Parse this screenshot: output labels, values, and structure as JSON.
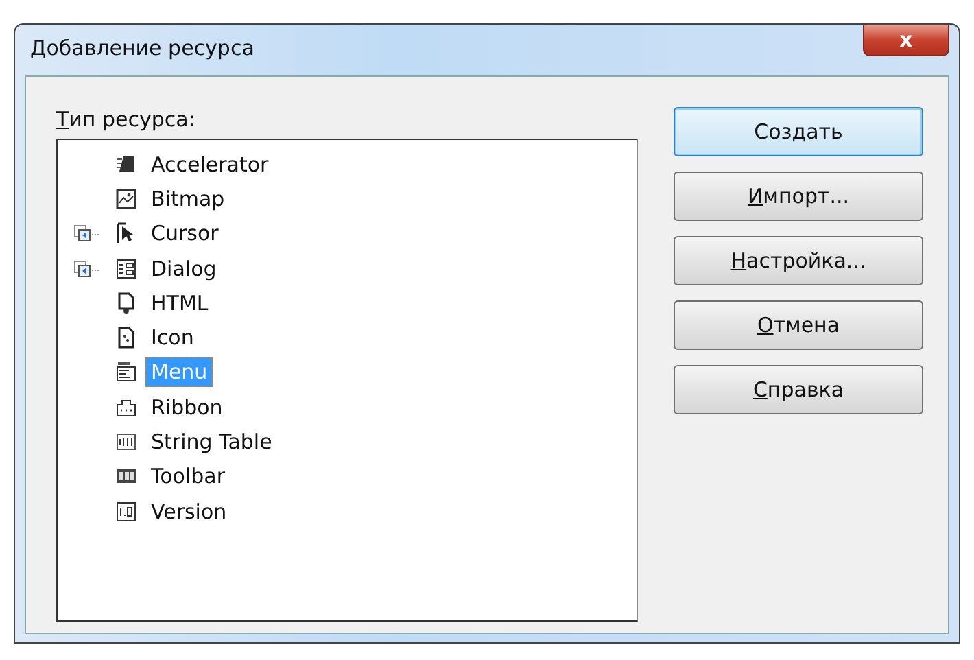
{
  "window": {
    "title": "Добавление ресурса",
    "close_glyph": "x"
  },
  "resource_type_label": "Тип ресурса:",
  "tree": {
    "items": [
      {
        "label": "Accelerator",
        "kind": "leaf",
        "selected": false
      },
      {
        "label": "Bitmap",
        "kind": "leaf",
        "selected": false
      },
      {
        "label": "Cursor",
        "kind": "group",
        "expanded": false,
        "selected": false
      },
      {
        "label": "Dialog",
        "kind": "group",
        "expanded": false,
        "selected": false
      },
      {
        "label": "HTML",
        "kind": "leaf",
        "selected": false
      },
      {
        "label": "Icon",
        "kind": "leaf",
        "selected": false
      },
      {
        "label": "Menu",
        "kind": "leaf",
        "selected": true
      },
      {
        "label": "Ribbon",
        "kind": "leaf",
        "selected": false
      },
      {
        "label": "String Table",
        "kind": "leaf",
        "selected": false
      },
      {
        "label": "Toolbar",
        "kind": "leaf",
        "selected": false
      },
      {
        "label": "Version",
        "kind": "leaf",
        "selected": false
      }
    ]
  },
  "buttons": [
    {
      "label": "Создать",
      "default": true,
      "mnemonic": false
    },
    {
      "label": "Импорт...",
      "default": false,
      "mnemonic": true
    },
    {
      "label": "Настройка...",
      "default": false,
      "mnemonic": true
    },
    {
      "label": "Отмена",
      "default": false,
      "mnemonic": true
    },
    {
      "label": "Справка",
      "default": false,
      "mnemonic": true
    }
  ]
}
